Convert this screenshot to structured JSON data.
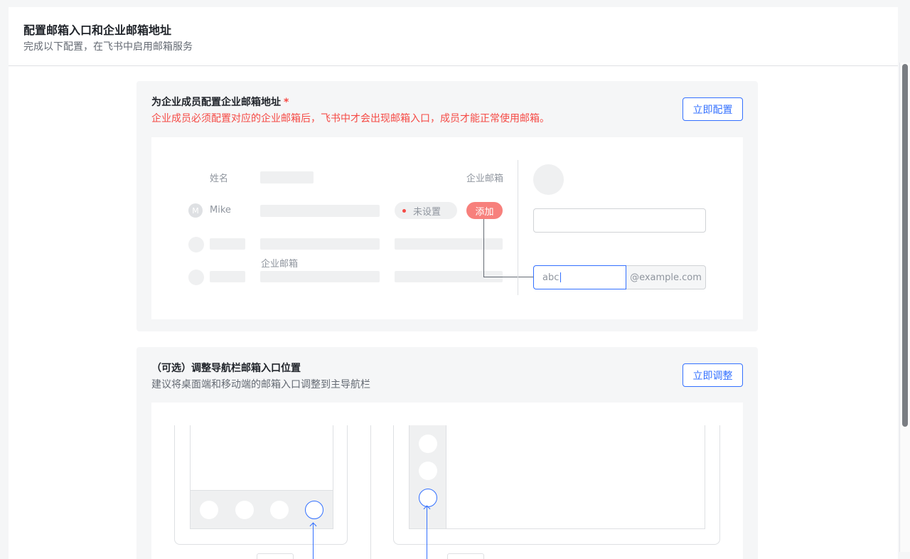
{
  "header": {
    "title": "配置邮箱入口和企业邮箱地址",
    "subtitle": "完成以下配置，在飞书中启用邮箱服务"
  },
  "card1": {
    "title": "为企业成员配置企业邮箱地址",
    "required_mark": "*",
    "warning": "企业成员必须配置对应的企业邮箱后，飞书中才会出现邮箱入口，成员才能正常使用邮箱。",
    "button_label": "立即配置",
    "illustration": {
      "col_name": "姓名",
      "col_email": "企业邮箱",
      "avatar_letter": "M",
      "member_name": "Mike",
      "status": "未设置",
      "add_label": "添加",
      "floating_label": "企业邮箱",
      "input_value": "abc",
      "domain": "@example.com"
    }
  },
  "card2": {
    "title": "（可选）调整导航栏邮箱入口位置",
    "desc": "建议将桌面端和移动端的邮箱入口调整到主导航栏",
    "button_label": "立即调整"
  },
  "colors": {
    "primary": "#3370ff",
    "danger": "#f54a45",
    "add_button": "#f7807c"
  }
}
